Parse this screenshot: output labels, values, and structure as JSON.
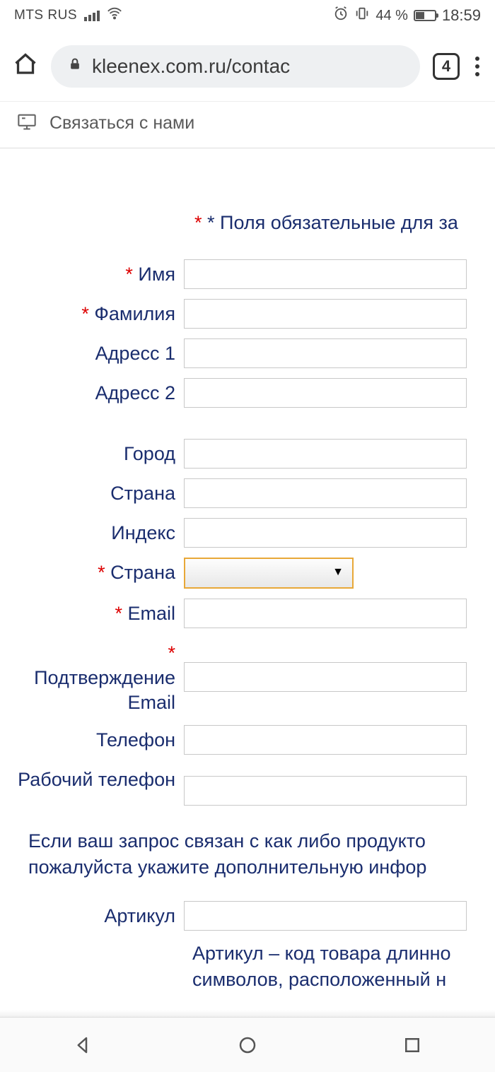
{
  "status": {
    "carrier": "MTS RUS",
    "battery_pct": "44 %",
    "time": "18:59"
  },
  "browser": {
    "url": "kleenex.com.ru/contac",
    "tabs_count": "4"
  },
  "page": {
    "header_title": "Связаться с нами",
    "required_note_prefix_ast": "*",
    "required_note_ast2": "*",
    "required_note_text": " Поля обязательные для за"
  },
  "form": {
    "fields": [
      {
        "label": "Имя",
        "required": true
      },
      {
        "label": "Фамилия",
        "required": true
      },
      {
        "label": "Адресс 1",
        "required": false
      },
      {
        "label": "Адресс 2",
        "required": false
      },
      {
        "label": "Город",
        "required": false
      },
      {
        "label": "Страна",
        "required": false
      },
      {
        "label": "Индекс",
        "required": false
      },
      {
        "label": "Страна",
        "required": true,
        "type": "select"
      },
      {
        "label": "Email",
        "required": true
      },
      {
        "label": "Подтверждение Email",
        "required": true
      },
      {
        "label": "Телефон",
        "required": false
      },
      {
        "label": "Рабочий телефон",
        "required": false
      }
    ],
    "note": "Если ваш запрос связан с как либо продукто\nпожалуйста укажите дополнительную инфор",
    "article_label": "Артикул",
    "article_hint": "Артикул – код товара длинно\nсимволов, расположенный н"
  }
}
